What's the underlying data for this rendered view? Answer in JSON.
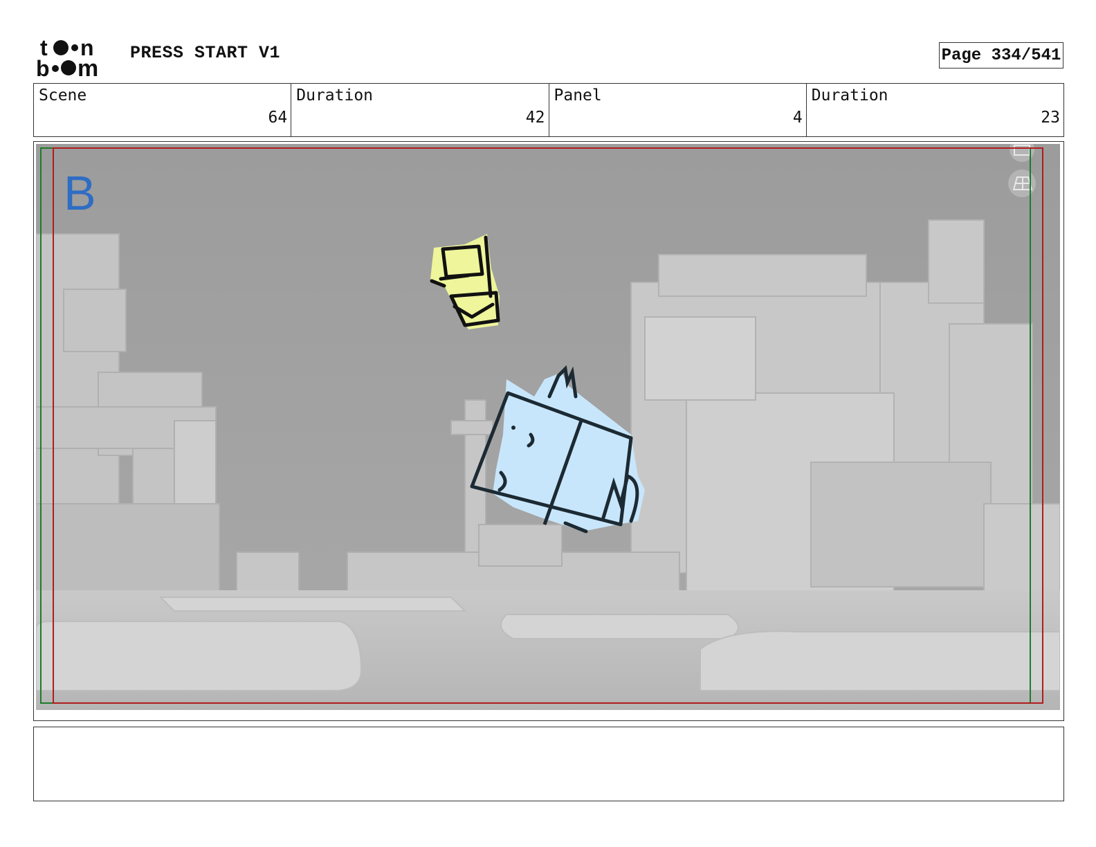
{
  "header": {
    "logo_text": "toon boom",
    "project_title": "PRESS START V1",
    "page_label": "Page 334/541"
  },
  "info": [
    {
      "label": "Scene",
      "value": "64"
    },
    {
      "label": "Duration",
      "value": "42"
    },
    {
      "label": "Panel",
      "value": "4"
    },
    {
      "label": "Duration",
      "value": "23"
    }
  ],
  "panel": {
    "letter": "B",
    "icons": [
      "camera-icon",
      "grid-icon"
    ],
    "colors": {
      "safe_area": "#b01c1c",
      "title_safe": "#1f7a2a",
      "letter": "#2f6dc4",
      "character_fill": "#c8e6fb",
      "block_fill": "#eef59a"
    }
  },
  "notes": {
    "text": ""
  }
}
